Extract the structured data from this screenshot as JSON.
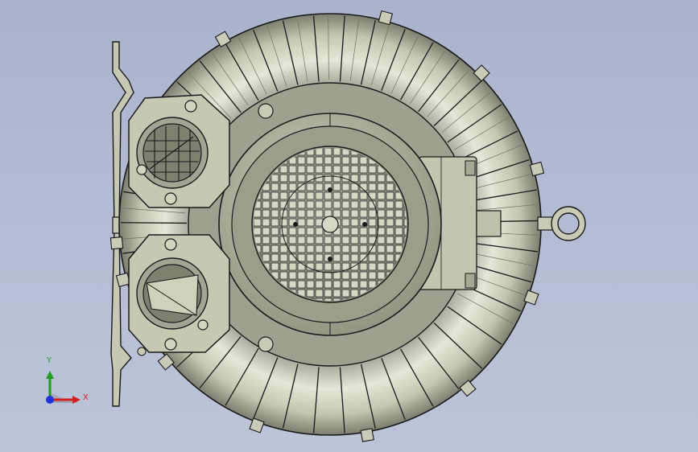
{
  "viewport": {
    "background": "#b3bcd3",
    "model": {
      "name": "ring-blower-side-channel",
      "body_color": "#c9cbb7",
      "edge_color": "#1a1a1a",
      "motor_fan_cover_color": "#a8aa98",
      "grid_cell_color": "#d6d8c6"
    }
  },
  "triad": {
    "x_label": "X",
    "y_label": "Y",
    "x_color": "#d42020",
    "y_color": "#1e9e1e",
    "z_color": "#2233dd"
  }
}
